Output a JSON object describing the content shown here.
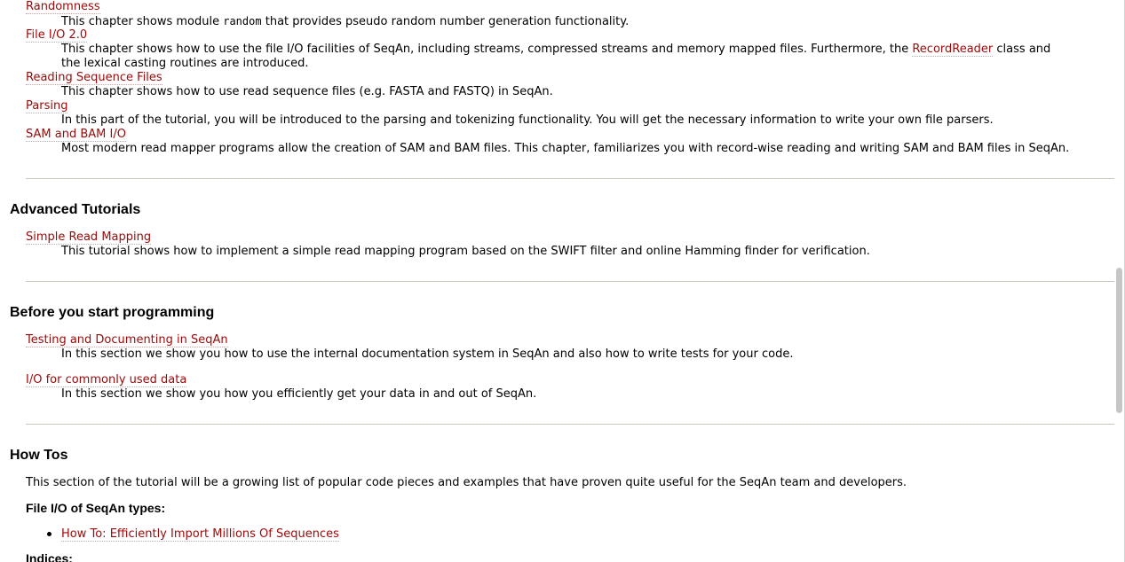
{
  "top_chapters": [
    {
      "title": "Randomness",
      "desc_before": "This chapter shows module ",
      "desc_code": "random",
      "desc_after": " that provides pseudo random number generation functionality."
    },
    {
      "title": "File I/O 2.0",
      "desc_line1_before": "This chapter shows how to use the file I/O facilities of SeqAn, including streams, compressed streams and memory mapped files. Furthermore, the ",
      "desc_line1_link": "RecordReader",
      "desc_line1_after": " class and",
      "desc_line2": "the lexical casting routines are introduced."
    },
    {
      "title": "Reading Sequence Files",
      "desc": "This chapter shows how to use read sequence files (e.g. FASTA and FASTQ) in SeqAn."
    },
    {
      "title": "Parsing",
      "desc": "In this part of the tutorial, you will be introduced to the parsing and tokenizing functionality. You will get the necessary information to write your own file parsers."
    },
    {
      "title": "SAM and BAM I/O",
      "desc": "Most modern read mapper programs allow the creation of SAM and BAM files. This chapter, familiarizes you with record-wise reading and writing SAM and BAM files in SeqAn."
    }
  ],
  "advanced": {
    "heading": "Advanced Tutorials",
    "items": [
      {
        "title": "Simple Read Mapping",
        "desc": "This tutorial shows how to implement a simple read mapping program based on the SWIFT filter and online Hamming finder for verification."
      }
    ]
  },
  "before": {
    "heading": "Before you start programming",
    "items": [
      {
        "title": "Testing and Documenting in SeqAn",
        "desc": "In this section we show you how to use the internal documentation system in SeqAn and also how to write tests for your code."
      },
      {
        "title": "I/O for commonly used data",
        "desc": "In this section we show you how you efficiently get your data in and out of SeqAn."
      }
    ]
  },
  "howtos": {
    "heading": "How Tos",
    "intro": "This section of the tutorial will be a growing list of popular code pieces and examples that have proven quite useful for the SeqAn team and developers.",
    "group1_heading": "File I/O of SeqAn types:",
    "group1_items": [
      "How To: Efficiently Import Millions Of Sequences"
    ],
    "group2_heading": "Indices:"
  },
  "colors": {
    "link": "#9c0909",
    "rule": "#c8c8b8"
  }
}
